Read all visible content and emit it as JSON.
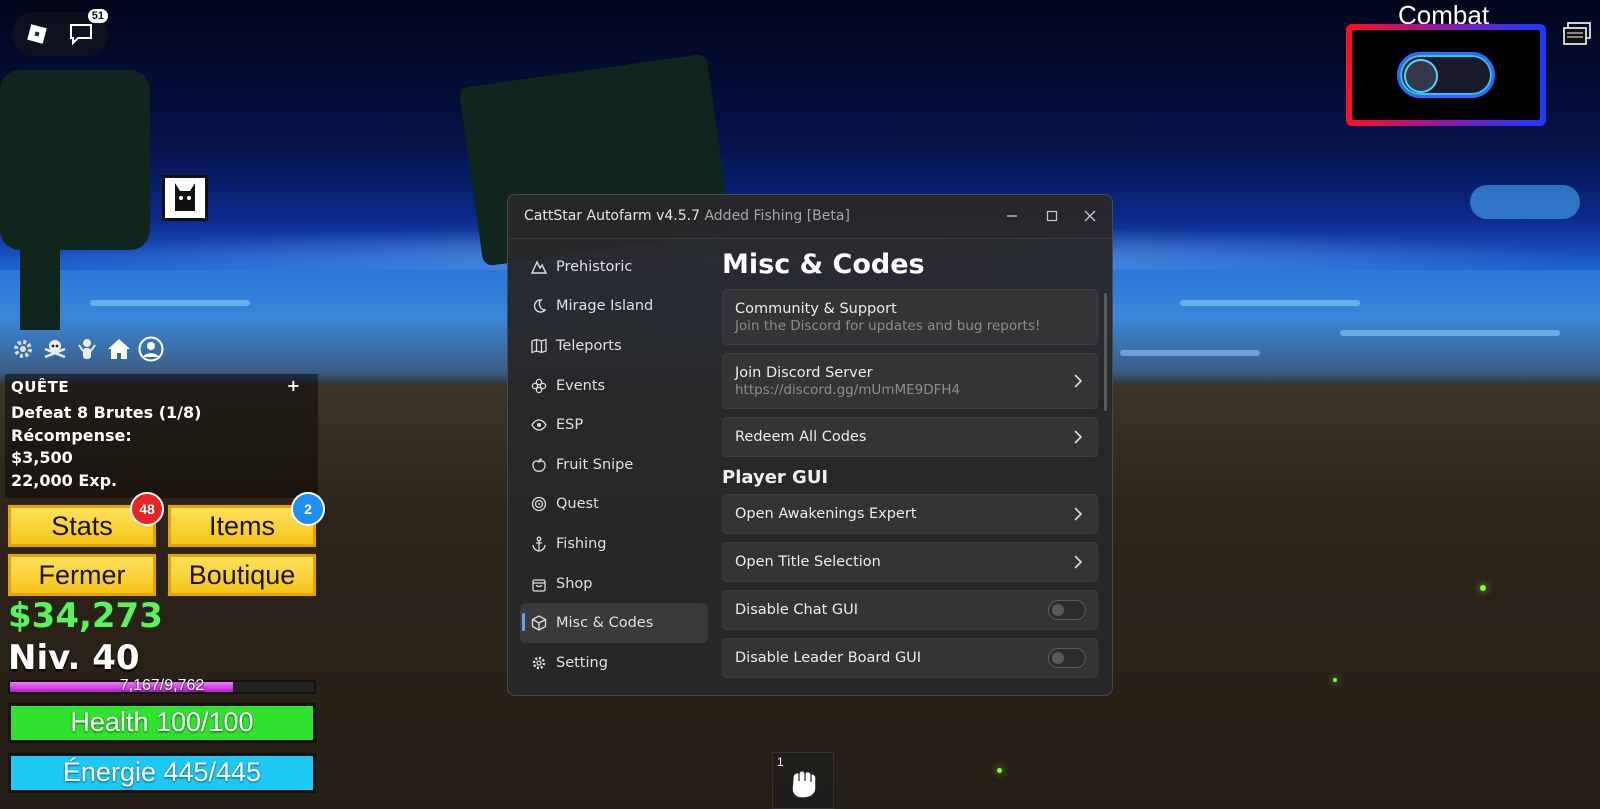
{
  "roblox": {
    "chat_badge": "51"
  },
  "hud": {
    "quest": {
      "title": "QUÊTE",
      "plus": "+",
      "objective": "Defeat 8 Brutes (1/8)",
      "reward_label": "Récompense:",
      "reward_money": "$3,500",
      "reward_exp": "22,000 Exp."
    },
    "buttons": {
      "stats": "Stats",
      "stats_badge": "48",
      "items": "Items",
      "items_badge": "2",
      "close": "Fermer",
      "shop": "Boutique"
    },
    "money": "$34,273",
    "level": "Niv. 40",
    "xp_text": "7,167/9,762",
    "xp_fraction": 0.734,
    "health": "Health 100/100",
    "energy": "Énergie 445/445",
    "colors": {
      "health": "#2fe22f",
      "energy": "#1ec8f5",
      "money": "#5bf35b"
    }
  },
  "combat": {
    "label": "Combat",
    "enabled": false
  },
  "window": {
    "title": "CattStar Autofarm v4.5.7",
    "subtitle": "Added Fishing [Beta]",
    "sidebar": {
      "items": [
        {
          "label": "Prehistoric",
          "icon": "mountain-icon"
        },
        {
          "label": "Mirage Island",
          "icon": "moon-icon"
        },
        {
          "label": "Teleports",
          "icon": "map-icon"
        },
        {
          "label": "Events",
          "icon": "flower-icon"
        },
        {
          "label": "ESP",
          "icon": "eye-icon"
        },
        {
          "label": "Fruit Snipe",
          "icon": "apple-icon"
        },
        {
          "label": "Quest",
          "icon": "target-icon"
        },
        {
          "label": "Fishing",
          "icon": "anchor-icon"
        },
        {
          "label": "Shop",
          "icon": "shopping-bag-icon"
        },
        {
          "label": "Misc & Codes",
          "icon": "cube-icon",
          "active": true
        },
        {
          "label": "Setting",
          "icon": "gear-icon"
        }
      ]
    },
    "content": {
      "page_title": "Misc & Codes",
      "community": {
        "title": "Community & Support",
        "sub": "Join the Discord for updates and bug reports!"
      },
      "discord": {
        "title": "Join Discord Server",
        "sub": "https://discord.gg/mUmME9DFH4"
      },
      "redeem": {
        "title": "Redeem All Codes"
      },
      "player_gui_title": "Player GUI",
      "awakenings": {
        "title": "Open Awakenings Expert"
      },
      "title_selection": {
        "title": "Open Title Selection"
      },
      "disable_chat": {
        "title": "Disable Chat GUI",
        "enabled": false
      },
      "disable_leaderboard": {
        "title": "Disable Leader Board GUI",
        "enabled": false
      }
    }
  },
  "hotbar": {
    "slot_number": "1",
    "slot_icon": "fist-icon"
  }
}
